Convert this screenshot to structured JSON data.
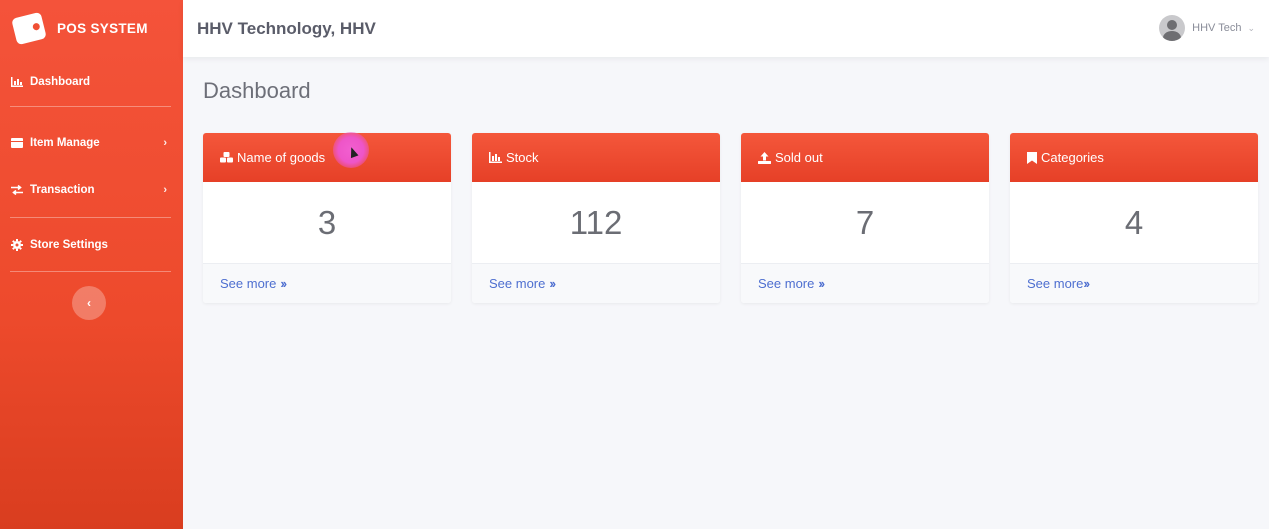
{
  "brand": {
    "title": "POS SYSTEM",
    "logo_icon": "wallet-icon"
  },
  "sidebar": {
    "items": [
      {
        "label": "Dashboard",
        "icon": "chart-icon",
        "has_submenu": false
      },
      {
        "label": "Item Manage",
        "icon": "table-icon",
        "has_submenu": true
      },
      {
        "label": "Transaction",
        "icon": "exchange-icon",
        "has_submenu": true
      },
      {
        "label": "Store Settings",
        "icon": "gear-icon",
        "has_submenu": false
      }
    ],
    "collapse_icon": "chevron-left-icon"
  },
  "header": {
    "company": "HHV Technology, HHV",
    "user": "HHV Tech"
  },
  "main": {
    "title": "Dashboard",
    "cards": [
      {
        "title": "Name of goods",
        "icon": "cubes-icon",
        "value": "3",
        "link": "See more"
      },
      {
        "title": "Stock",
        "icon": "chart-icon",
        "value": "112",
        "link": "See more"
      },
      {
        "title": "Sold out",
        "icon": "upload-icon",
        "value": "7",
        "link": "See more"
      },
      {
        "title": "Categories",
        "icon": "bookmark-icon",
        "value": "4",
        "link": "See more"
      }
    ]
  },
  "colors": {
    "accent": "#f05034",
    "link": "#4e6fd0",
    "background": "#f6f7fa"
  }
}
